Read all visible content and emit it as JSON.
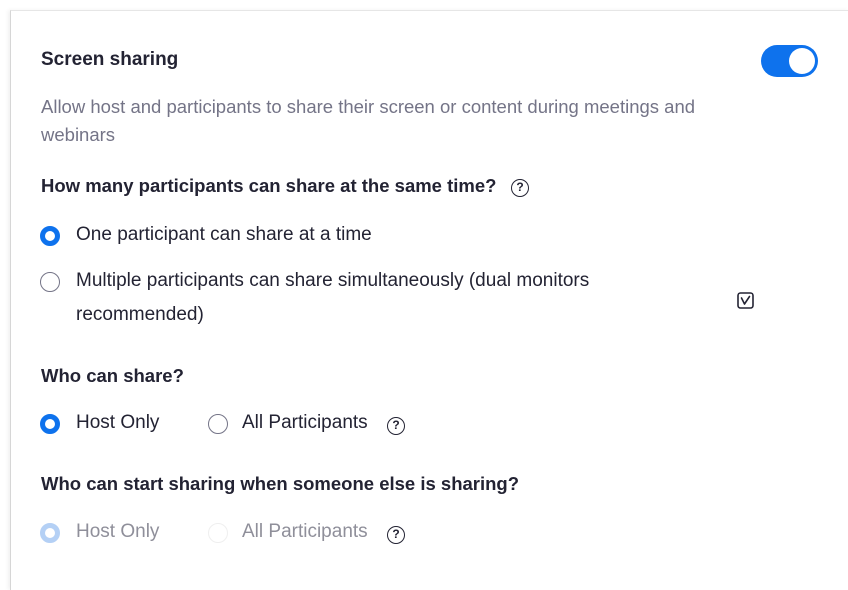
{
  "section": {
    "title": "Screen sharing",
    "description": "Allow host and participants to share their screen or content during meetings and webinars",
    "enabled": true,
    "accent_color": "#0e72ed"
  },
  "share_count": {
    "question": "How many participants can share at the same time?",
    "help_icon": "?",
    "options": [
      {
        "label": "One participant can share at a time",
        "selected": true
      },
      {
        "label": "Multiple participants can share simultaneously (dual monitors",
        "label_line2": "recommended)",
        "selected": false
      }
    ]
  },
  "who_can_share": {
    "question": "Who can share?",
    "help_icon": "?",
    "options": [
      {
        "label": "Host Only",
        "selected": true
      },
      {
        "label": "All Participants",
        "selected": false
      }
    ]
  },
  "who_can_start": {
    "question": "Who can start sharing when someone else is sharing?",
    "help_icon": "?",
    "disabled": true,
    "options": [
      {
        "label": "Host Only",
        "selected": true
      },
      {
        "label": "All Participants",
        "selected": false
      }
    ]
  },
  "icons": {
    "toggle": "toggle-switch-icon",
    "help": "question-circle-icon",
    "check_square": "check-square-icon"
  }
}
